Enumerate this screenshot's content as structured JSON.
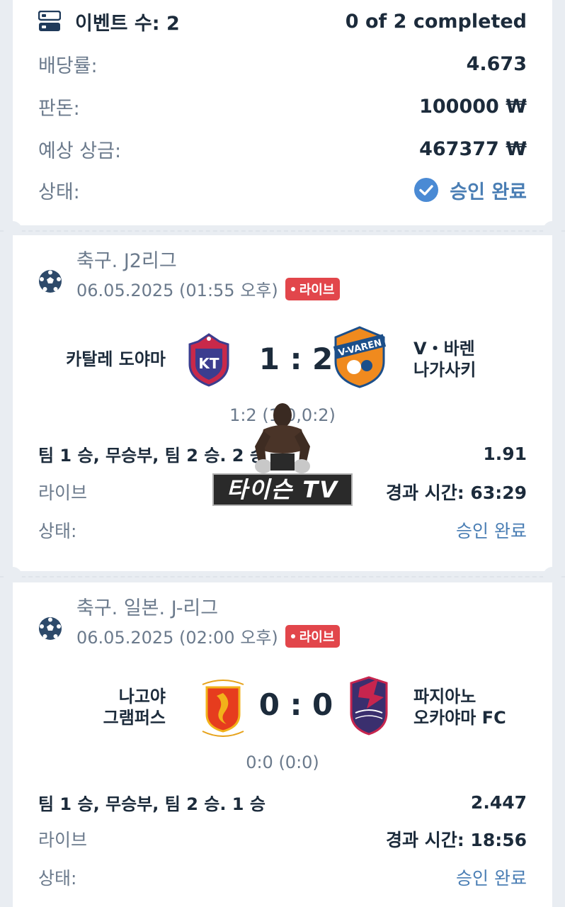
{
  "summary": {
    "events_label": "이벤트 수: 2",
    "completed": "0 of 2 completed",
    "odds_label": "배당률:",
    "odds_value": "4.673",
    "stake_label": "판돈:",
    "stake_value": "100000 ₩",
    "payout_label": "예상 상금:",
    "payout_value": "467377 ₩",
    "status_label": "상태:",
    "status_value": "승인 완료",
    "icon": "list-icon",
    "status_icon": "check-circle-icon"
  },
  "matches": [
    {
      "league": "축구. J2리그",
      "date": "06.05.2025 (01:55 오후)",
      "live_badge": "라이브",
      "home_team": "카탈레 도야마",
      "away_team_line1": "V・바렌",
      "away_team_line2": "나가사키",
      "score": "1 : 2",
      "half_score": "1:2 (1:0,0:2)",
      "bet": "팀 1 승, 무승부, 팀 2 승. 2 승",
      "odd": "1.91",
      "live_label": "라이브",
      "elapsed": "경과 시간: 63:29",
      "status_label": "상태:",
      "status_value": "승인 완료"
    },
    {
      "league": "축구. 일본. J-리그",
      "date": "06.05.2025 (02:00 오후)",
      "live_badge": "라이브",
      "home_team_line1": "나고야",
      "home_team_line2": "그램퍼스",
      "away_team_line1": "파지아노",
      "away_team_line2": "오카야마 FC",
      "score": "0 : 0",
      "half_score": "0:0 (0:0)",
      "bet": "팀 1 승, 무승부, 팀 2 승. 1 승",
      "odd": "2.447",
      "live_label": "라이브",
      "elapsed": "경과 시간: 18:56",
      "status_label": "상태:",
      "status_value": "승인 완료"
    }
  ],
  "watermark": "타이슨 TV",
  "colors": {
    "accent_blue": "#4a7eb4",
    "live_red": "#e2464b",
    "background": "#e9edf2"
  }
}
